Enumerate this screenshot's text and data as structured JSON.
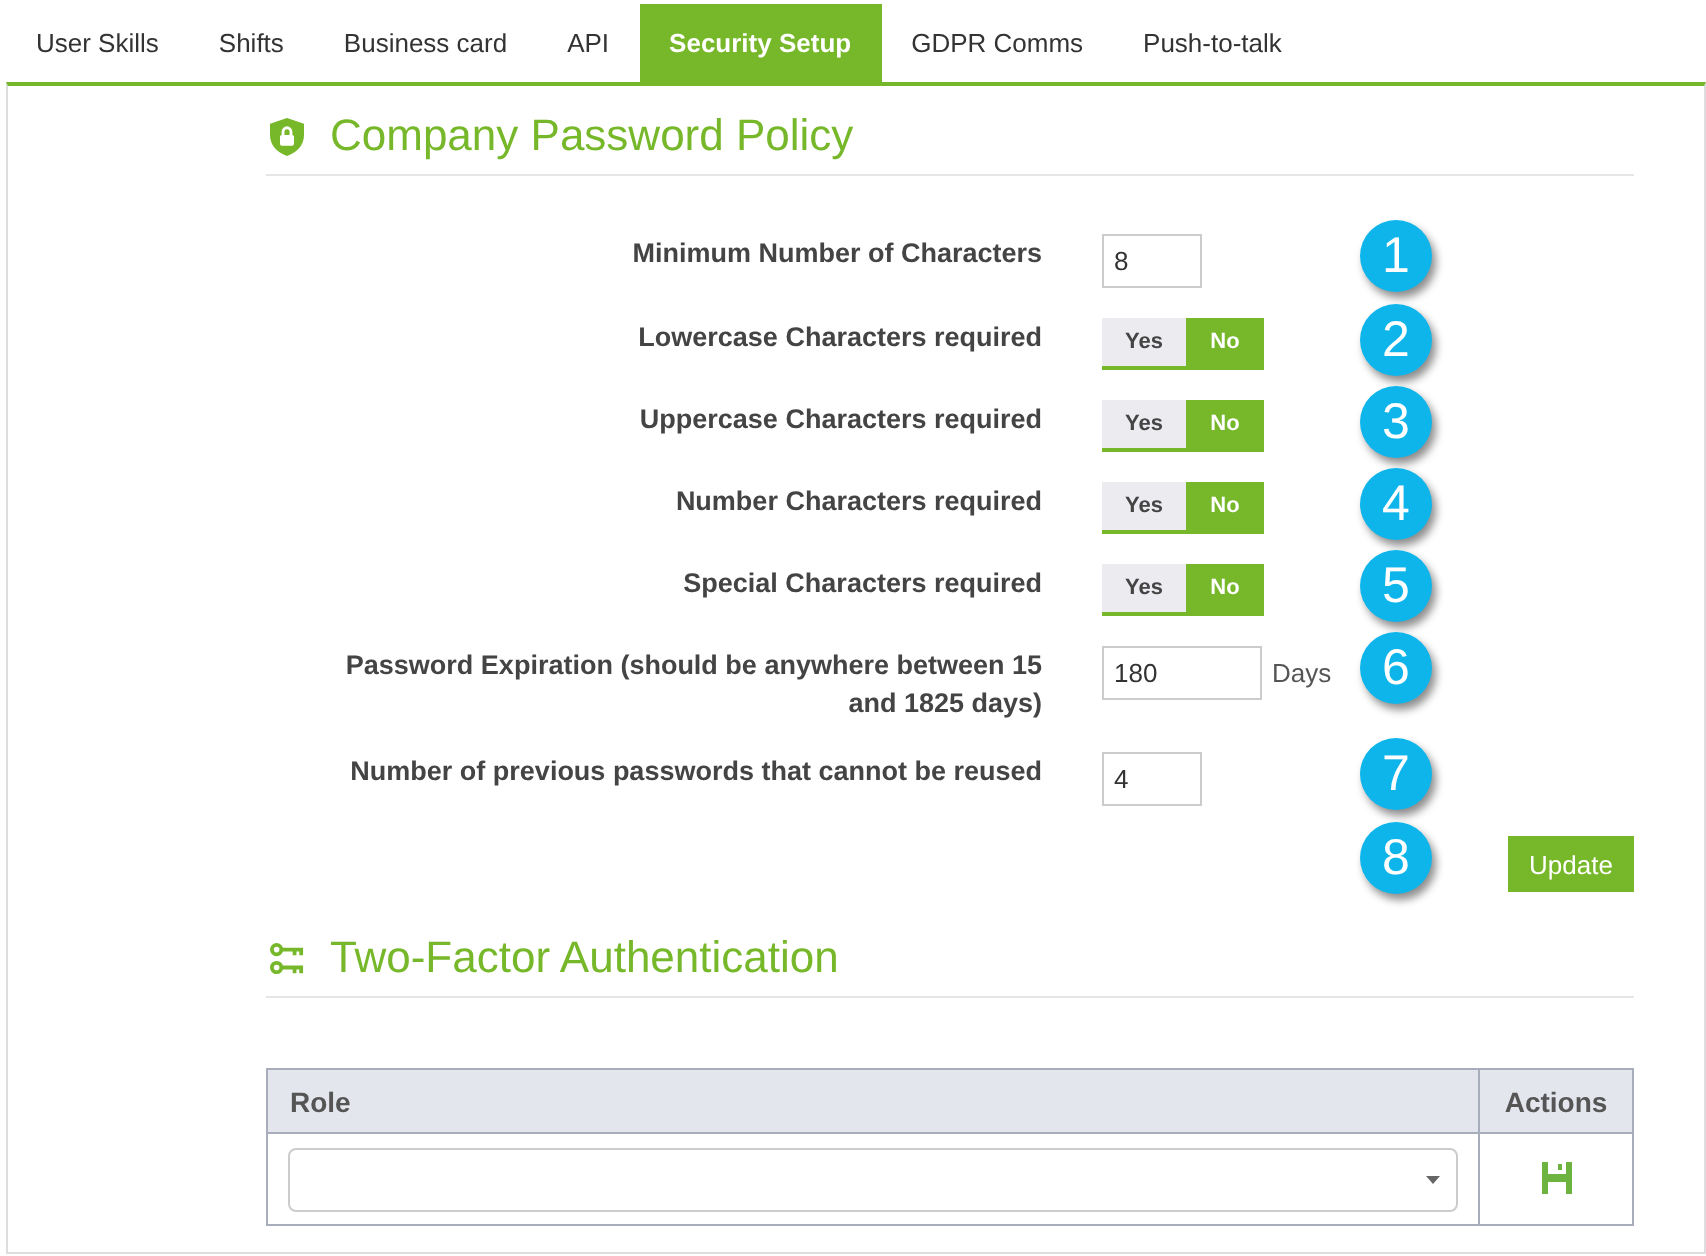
{
  "tabs": [
    {
      "label": "User Skills",
      "selected": false
    },
    {
      "label": "Shifts",
      "selected": false
    },
    {
      "label": "Business card",
      "selected": false
    },
    {
      "label": "API",
      "selected": false
    },
    {
      "label": "Security Setup",
      "selected": true
    },
    {
      "label": "GDPR Comms",
      "selected": false
    },
    {
      "label": "Push-to-talk",
      "selected": false
    }
  ],
  "password_policy": {
    "title": "Company Password Policy",
    "fields": [
      {
        "kind": "input",
        "label": "Minimum Number of Characters",
        "value": "8",
        "callout": "1"
      },
      {
        "kind": "toggle",
        "label": "Lowercase Characters required",
        "options": [
          {
            "label": "Yes",
            "selected": false
          },
          {
            "label": "No",
            "selected": true
          }
        ],
        "callout": "2"
      },
      {
        "kind": "toggle",
        "label": "Uppercase Characters required",
        "options": [
          {
            "label": "Yes",
            "selected": false
          },
          {
            "label": "No",
            "selected": true
          }
        ],
        "callout": "3"
      },
      {
        "kind": "toggle",
        "label": "Number Characters required",
        "options": [
          {
            "label": "Yes",
            "selected": false
          },
          {
            "label": "No",
            "selected": true
          }
        ],
        "callout": "4"
      },
      {
        "kind": "toggle",
        "label": "Special Characters required",
        "options": [
          {
            "label": "Yes",
            "selected": false
          },
          {
            "label": "No",
            "selected": true
          }
        ],
        "callout": "5"
      },
      {
        "kind": "input",
        "label": "Password Expiration (should be anywhere between 15 and 1825 days)",
        "value": "180",
        "unit": "Days",
        "callout": "6"
      },
      {
        "kind": "input",
        "label": "Number of previous passwords that cannot be reused",
        "value": "4",
        "callout": "7"
      }
    ],
    "update_button": {
      "label": "Update",
      "callout": "8"
    }
  },
  "two_factor": {
    "title": "Two-Factor Authentication",
    "table": {
      "columns": [
        "Role",
        "Actions"
      ],
      "rows": [
        {
          "kind": "role_select"
        }
      ]
    }
  }
}
